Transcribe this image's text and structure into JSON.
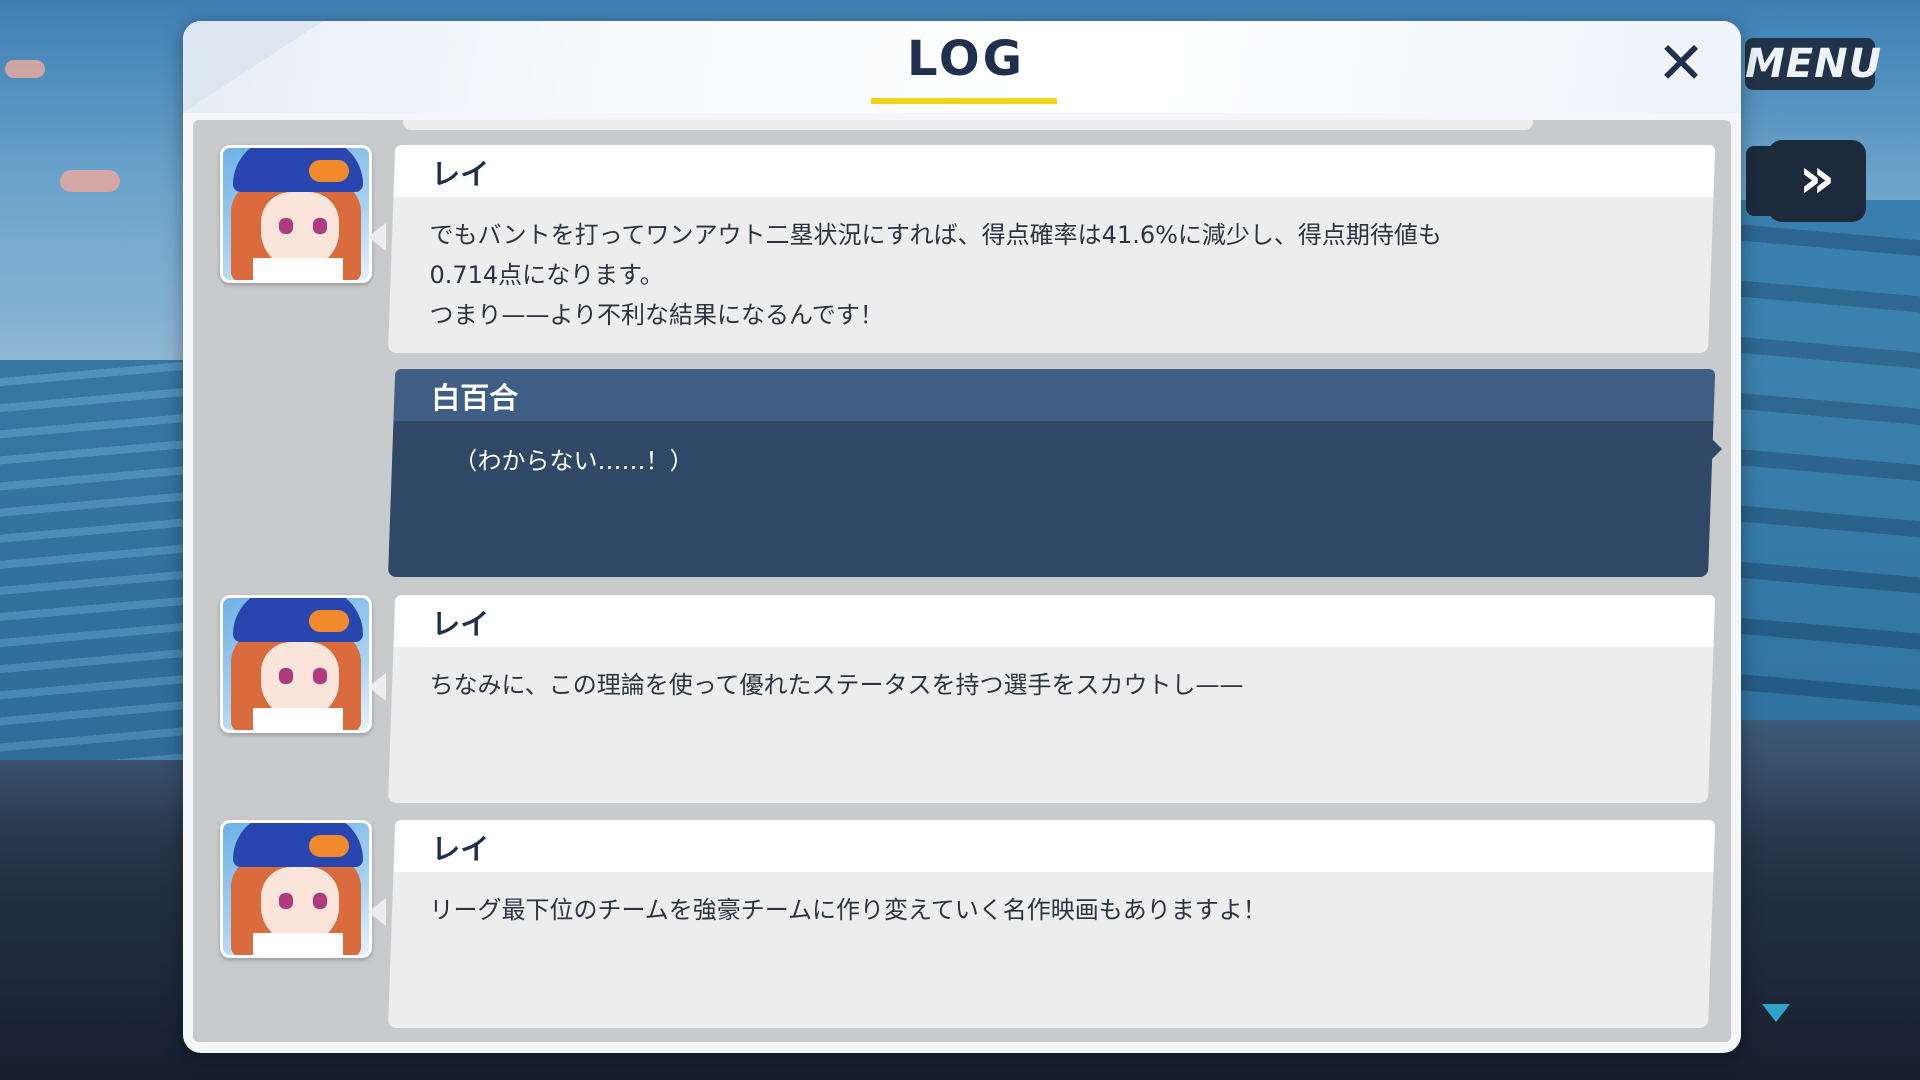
{
  "header": {
    "title": "LOG",
    "close_icon": "close-icon"
  },
  "hud": {
    "menu_label": "MENU",
    "skip_icon": "»"
  },
  "log": {
    "entries": [
      {
        "speaker": "レイ",
        "text": "でもバントを打ってワンアウト二塁状況にすれば、得点確率は41.6%に減少し、得点期待値も\n0.714点になります。\nつまり——より不利な結果になるんです！",
        "has_portrait": true,
        "highlighted": false
      },
      {
        "speaker": "白百合",
        "text": "（わからない……！）",
        "has_portrait": false,
        "highlighted": true
      },
      {
        "speaker": "レイ",
        "text": "ちなみに、この理論を使って優れたステータスを持つ選手をスカウトし——",
        "has_portrait": true,
        "highlighted": false
      },
      {
        "speaker": "レイ",
        "text": "リーグ最下位のチームを強豪チームに作り変えていく名作映画もありますよ！",
        "has_portrait": true,
        "highlighted": false
      }
    ]
  },
  "colors": {
    "title_underline": "#f3d21a",
    "highlight_bubble": "#2f4866",
    "highlight_namebar": "#3e5e85"
  }
}
